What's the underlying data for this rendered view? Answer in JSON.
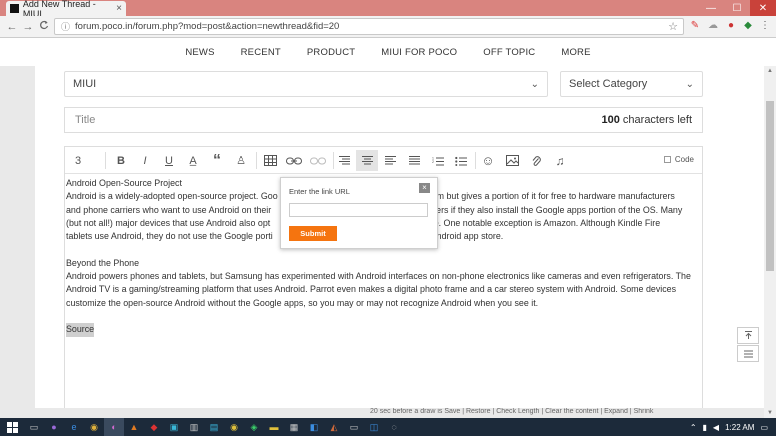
{
  "browser": {
    "tab_title": "Add New Thread - MIUI",
    "tab_close": "×",
    "url": "forum.poco.in/forum.php?mod=post&action=newthread&fid=20",
    "back": "←",
    "forward": "→",
    "reload": "C",
    "info": "ⓘ",
    "star": "☆",
    "menu": "⋮",
    "win_min": "—",
    "win_max": "☐",
    "win_close": "✕"
  },
  "nav": {
    "items": [
      "NEWS",
      "RECENT",
      "PRODUCT",
      "MIUI FOR POCO",
      "OFF TOPIC",
      "MORE"
    ]
  },
  "form": {
    "forum_select": "MIUI",
    "category_select": "Select Category",
    "title_placeholder": "Title",
    "char_count": "100",
    "char_suffix": " characters left"
  },
  "toolbar": {
    "font_size": "3",
    "code_label": "Code"
  },
  "content": {
    "heading1": "Android Open-Source Project",
    "para1_line1": "Android is a widely-adopted open-source project. Goo",
    "para1_line1b": "rm but gives a portion of it for free to hardware manufacturers",
    "para1_line2": "and phone carriers who want to use Android on their",
    "para1_line2b": "urers if they also install the Google apps portion of the OS. Many",
    "para1_line3": "(but not all!) major devices that use Android also opt",
    "para1_line3b": "ce. One notable exception is Amazon. Although Kindle Fire",
    "para1_line4": "tablets use Android, they do not use the Google porti",
    "para1_line4b": "Android app store.",
    "heading2": "Beyond the Phone",
    "para2": "Android powers phones and tablets, but Samsung has experimented with Android interfaces on non-phone electronics like cameras and even refrigerators. The Android TV is a gaming/streaming platform that uses Android. Parrot even makes a digital photo frame and a car stereo system with Android. Some devices customize the open-source Android without the Google apps, so you may or may not recognize Android when you see it.",
    "source": "Source"
  },
  "popup": {
    "label": "Enter the link URL",
    "close": "×",
    "input_value": "",
    "submit": "Submit"
  },
  "bottom_text": "20 sec before a draw is Save | Restore | Check Length | Clear the content | Expand | Shrink",
  "taskbar": {
    "time": "1:22 AM"
  },
  "colors": {
    "accent": "#f5740f",
    "titlebar": "#d9847f",
    "taskbar": "#1c2a3a"
  }
}
